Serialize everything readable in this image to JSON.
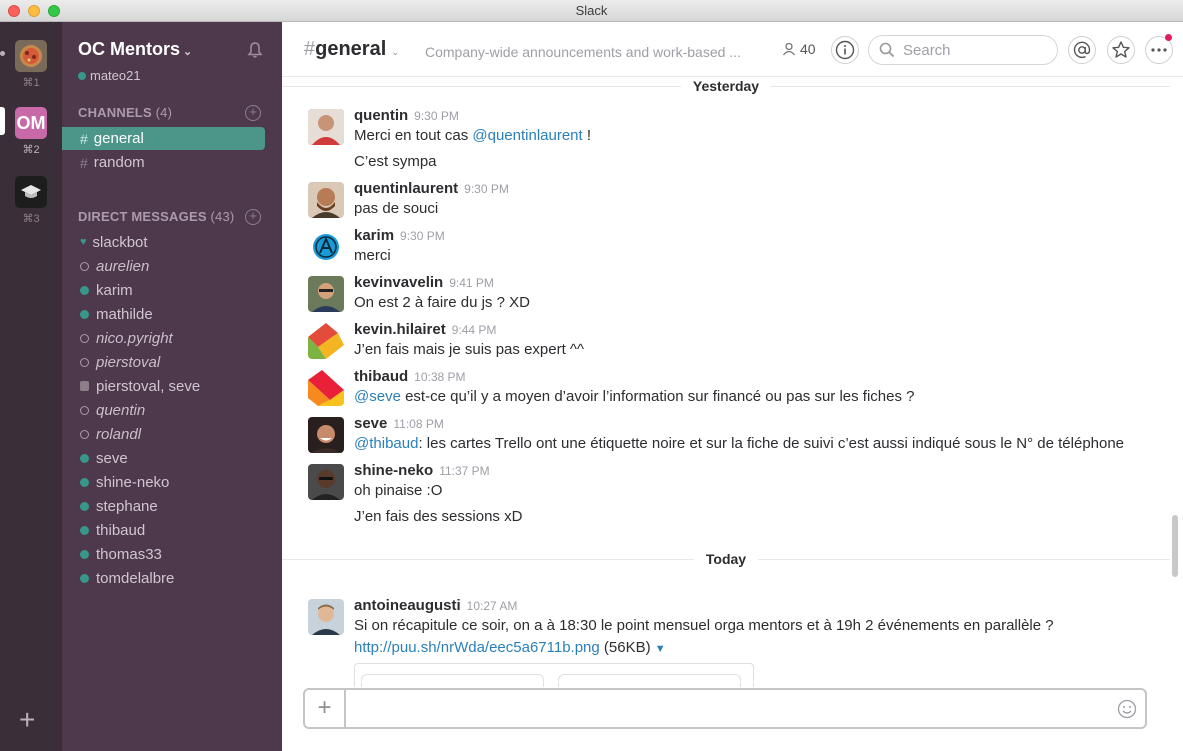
{
  "window": {
    "title": "Slack"
  },
  "teams": [
    {
      "shortcut": "⌘1"
    },
    {
      "initials": "OM",
      "shortcut": "⌘2"
    },
    {
      "shortcut": "⌘3"
    }
  ],
  "team": {
    "name": "OC Mentors",
    "user": "mateo21"
  },
  "channels_section": {
    "title": "CHANNELS",
    "count": "(4)"
  },
  "channels": [
    {
      "name": "general",
      "active": true
    },
    {
      "name": "random",
      "active": false
    }
  ],
  "dm_section": {
    "title": "DIRECT MESSAGES",
    "count": "(43)"
  },
  "dms": [
    {
      "name": "slackbot",
      "status": "bot"
    },
    {
      "name": "aurelien",
      "status": "away"
    },
    {
      "name": "karim",
      "status": "online"
    },
    {
      "name": "mathilde",
      "status": "online"
    },
    {
      "name": "nico.pyright",
      "status": "away"
    },
    {
      "name": "pierstoval",
      "status": "away"
    },
    {
      "name": "pierstoval, seve",
      "status": "group"
    },
    {
      "name": "quentin",
      "status": "away"
    },
    {
      "name": "rolandl",
      "status": "away"
    },
    {
      "name": "seve",
      "status": "online"
    },
    {
      "name": "shine-neko",
      "status": "online"
    },
    {
      "name": "stephane",
      "status": "online"
    },
    {
      "name": "thibaud",
      "status": "online"
    },
    {
      "name": "thomas33",
      "status": "online"
    },
    {
      "name": "tomdelalbre",
      "status": "online"
    }
  ],
  "header": {
    "hash": "#",
    "channel": "general",
    "topic": "Company-wide announcements and work-based ...",
    "member_count": "40",
    "search_placeholder": "Search"
  },
  "dividers": {
    "yesterday": "Yesterday",
    "today": "Today"
  },
  "messages": [
    {
      "author": "quentin",
      "time": "9:30 PM",
      "pre": "Merci en tout cas ",
      "mention": "@quentinlaurent",
      "post": " !",
      "extra": "C’est sympa",
      "avatar_color": "#c25b4a"
    },
    {
      "author": "quentinlaurent",
      "time": "9:30 PM",
      "text": "pas de souci",
      "avatar_color": "#8a5a3a"
    },
    {
      "author": "karim",
      "time": "9:30 PM",
      "text": "merci",
      "avatar_color": "#1a9ad6"
    },
    {
      "author": "kevinvavelin",
      "time": "9:41 PM",
      "text": "On est 2 à faire du js ? XD",
      "avatar_color": "#5a6a4a"
    },
    {
      "author": "kevin.hilairet",
      "time": "9:44 PM",
      "text": "J’en fais mais je suis pas expert ^^",
      "avatar_color": "#e34b3a"
    },
    {
      "author": "thibaud",
      "time": "10:38 PM",
      "mention": "@seve",
      "post": " est-ce qu’il y a moyen d’avoir l’information sur financé ou pas sur les fiches ?",
      "avatar_color": "#e8203a"
    },
    {
      "author": "seve",
      "time": "11:08 PM",
      "mention": "@thibaud",
      "post": ": les cartes Trello ont une étiquette noire et sur la fiche de suivi c’est aussi indiqué sous le N° de téléphone",
      "avatar_color": "#3a2a2a"
    },
    {
      "author": "shine-neko",
      "time": "11:37 PM",
      "text": "oh pinaise :O",
      "extra": "J’en fais des sessions xD",
      "avatar_color": "#3a3a3a"
    },
    {
      "author": "antoineaugusti",
      "time": "10:27 AM",
      "text": "Si on récapitule ce soir, on a à 18:30 le point mensuel orga mentors et à 19h 2 événements en parallèle ?",
      "link": "http://puu.sh/nrWda/eec5a6711b.png",
      "link_size": "(56KB)",
      "avatar_color": "#7a8a9a"
    }
  ],
  "composer": {
    "value": ""
  }
}
